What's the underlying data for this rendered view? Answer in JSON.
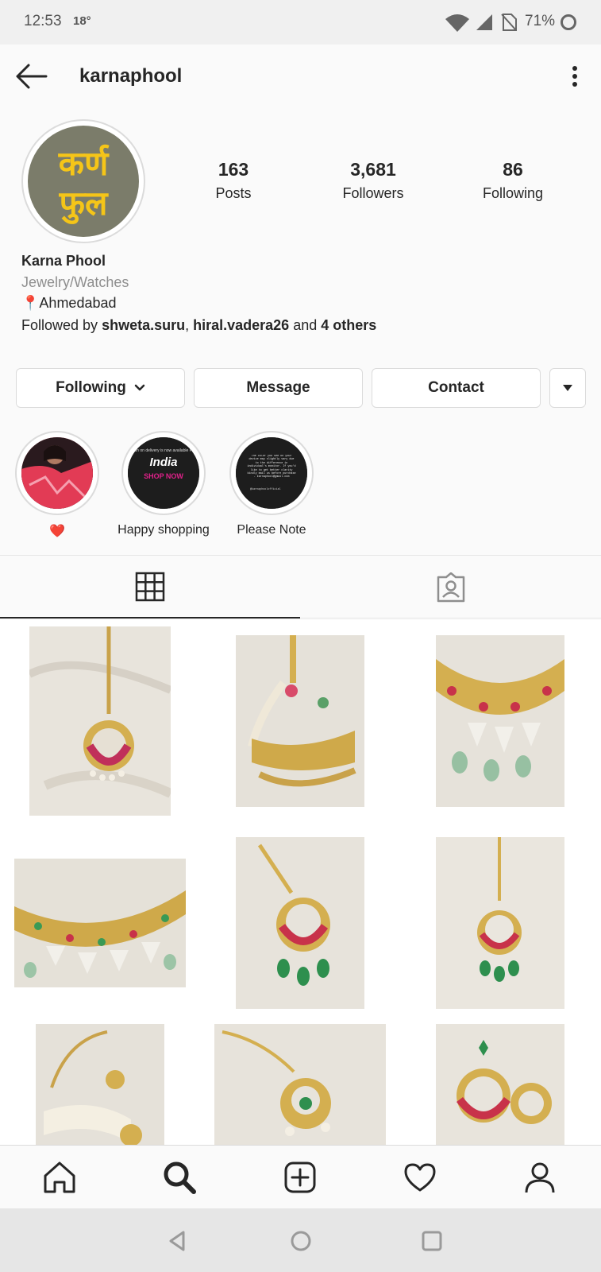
{
  "status_bar": {
    "time": "12:53",
    "temperature": "18°",
    "battery": "71%"
  },
  "header": {
    "username": "karnaphool"
  },
  "profile": {
    "avatar_text_line1": "कर्ण",
    "avatar_text_line2": "फुल",
    "stats": [
      {
        "value": "163",
        "label": "Posts"
      },
      {
        "value": "3,681",
        "label": "Followers"
      },
      {
        "value": "86",
        "label": "Following"
      }
    ],
    "name": "Karna Phool",
    "category": "Jewelry/Watches",
    "location_pin": "📍",
    "location": "Ahmedabad",
    "followed_by_prefix": "Followed by ",
    "followed_user1": "shweta.suru",
    "followed_sep": ", ",
    "followed_user2": "hiral.vadera26",
    "followed_and": " and ",
    "followed_others": "4 others"
  },
  "actions": {
    "following_label": "Following",
    "message_label": "Message",
    "contact_label": "Contact"
  },
  "highlights": [
    {
      "label": "❤️"
    },
    {
      "label": "Happy shopping",
      "img_line1": "cash on delivery is now available Pan",
      "img_big": "India",
      "img_pink": "SHOP NOW"
    },
    {
      "label": "Please Note",
      "img_text": "The color you see on your device may slightly vary due to the difference in individual's monitor. If you'd like to get better clarity kindly mail us before purchase - karnaphool@gmail.com",
      "img_handle": "@karnaphoolofficial"
    }
  ],
  "colors": {
    "accent_text": "#262626",
    "muted_text": "#8e8e8e",
    "border": "#dbdbdb",
    "avatar_bg": "#7b7c6a",
    "avatar_text": "#f5c518",
    "shop_now_pink": "#e0218a"
  },
  "grid_posts_visible": 9
}
